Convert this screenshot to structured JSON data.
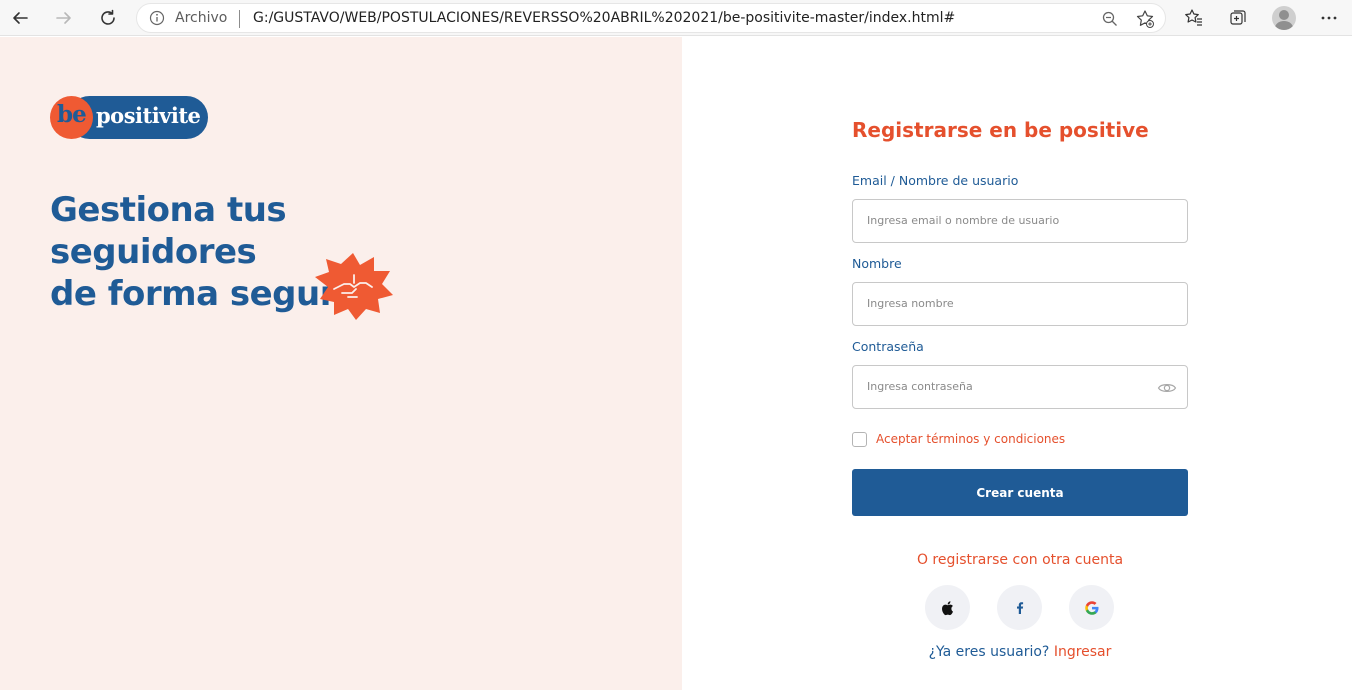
{
  "browser": {
    "security_label": "Archivo",
    "url": "G:/GUSTAVO/WEB/POSTULACIONES/REVERSSO%20ABRIL%202021/be-positivite-master/index.html#"
  },
  "brand": {
    "logo_be": "be",
    "logo_positivite": "positivite",
    "colors": {
      "primary": "#1f5b96",
      "accent": "#e5502d",
      "panel": "#fbefeb"
    }
  },
  "hero": {
    "line1": "Gestiona tus seguidores",
    "line2": "de forma segura"
  },
  "form": {
    "title": "Registrarse en be positive",
    "email_label": "Email / Nombre de usuario",
    "email_placeholder": "Ingresa email o nombre de usuario",
    "name_label": "Nombre",
    "name_placeholder": "Ingresa nombre",
    "password_label": "Contraseña",
    "password_placeholder": "Ingresa contraseña",
    "terms_label": "Aceptar términos y condiciones",
    "terms_checked": false,
    "submit_label": "Crear cuenta",
    "alt_signup": "O registrarse con otra cuenta",
    "social": [
      "apple-icon",
      "facebook-icon",
      "google-icon"
    ],
    "login_question": "¿Ya eres usuario?",
    "login_link": "Ingresar"
  }
}
